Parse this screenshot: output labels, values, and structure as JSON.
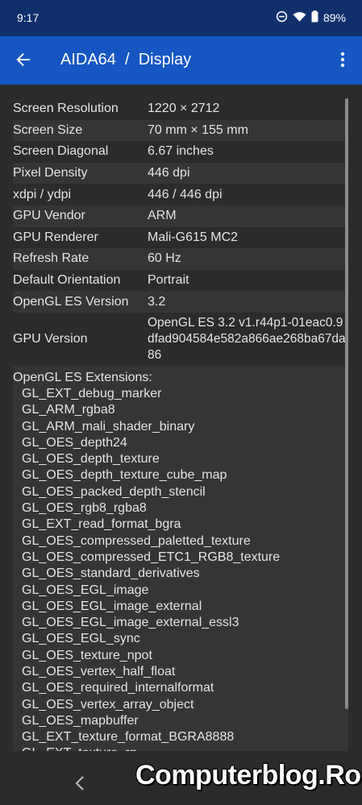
{
  "status_bar": {
    "time": "9:17",
    "battery": "89%",
    "icons": [
      "dnd-icon",
      "wifi-icon",
      "battery-icon"
    ]
  },
  "toolbar": {
    "title": "AIDA64  /  Display",
    "back_icon": "arrow-left-icon",
    "menu_icon": "more-vert-icon"
  },
  "rows": [
    {
      "label": "Screen Resolution",
      "value": "1220 × 2712"
    },
    {
      "label": "Screen Size",
      "value": "70 mm × 155 mm"
    },
    {
      "label": "Screen Diagonal",
      "value": "6.67 inches"
    },
    {
      "label": "Pixel Density",
      "value": "446 dpi"
    },
    {
      "label": "xdpi / ydpi",
      "value": "446 / 446 dpi"
    },
    {
      "label": "GPU Vendor",
      "value": "ARM"
    },
    {
      "label": "GPU Renderer",
      "value": "Mali-G615 MC2"
    },
    {
      "label": "Refresh Rate",
      "value": "60 Hz"
    },
    {
      "label": "Default Orientation",
      "value": "Portrait"
    },
    {
      "label": "OpenGL ES Version",
      "value": "3.2"
    },
    {
      "label": "GPU Version",
      "value": "OpenGL ES 3.2 v1.r44p1-01eac0.9dfad904584e582a866ae268ba67da86"
    }
  ],
  "extensions": {
    "header": "OpenGL ES Extensions:",
    "items": [
      "GL_EXT_debug_marker",
      "GL_ARM_rgba8",
      "GL_ARM_mali_shader_binary",
      "GL_OES_depth24",
      "GL_OES_depth_texture",
      "GL_OES_depth_texture_cube_map",
      "GL_OES_packed_depth_stencil",
      "GL_OES_rgb8_rgba8",
      "GL_EXT_read_format_bgra",
      "GL_OES_compressed_paletted_texture",
      "GL_OES_compressed_ETC1_RGB8_texture",
      "GL_OES_standard_derivatives",
      "GL_OES_EGL_image",
      "GL_OES_EGL_image_external",
      "GL_OES_EGL_image_external_essl3",
      "GL_OES_EGL_sync",
      "GL_OES_texture_npot",
      "GL_OES_vertex_half_float",
      "GL_OES_required_internalformat",
      "GL_OES_vertex_array_object",
      "GL_OES_mapbuffer",
      "GL_EXT_texture_format_BGRA8888",
      "GL_EXT_texture_rg"
    ]
  },
  "navigation_bar": {
    "back_icon": "nav-back-icon"
  },
  "watermark": "Computerblog.Ro"
}
